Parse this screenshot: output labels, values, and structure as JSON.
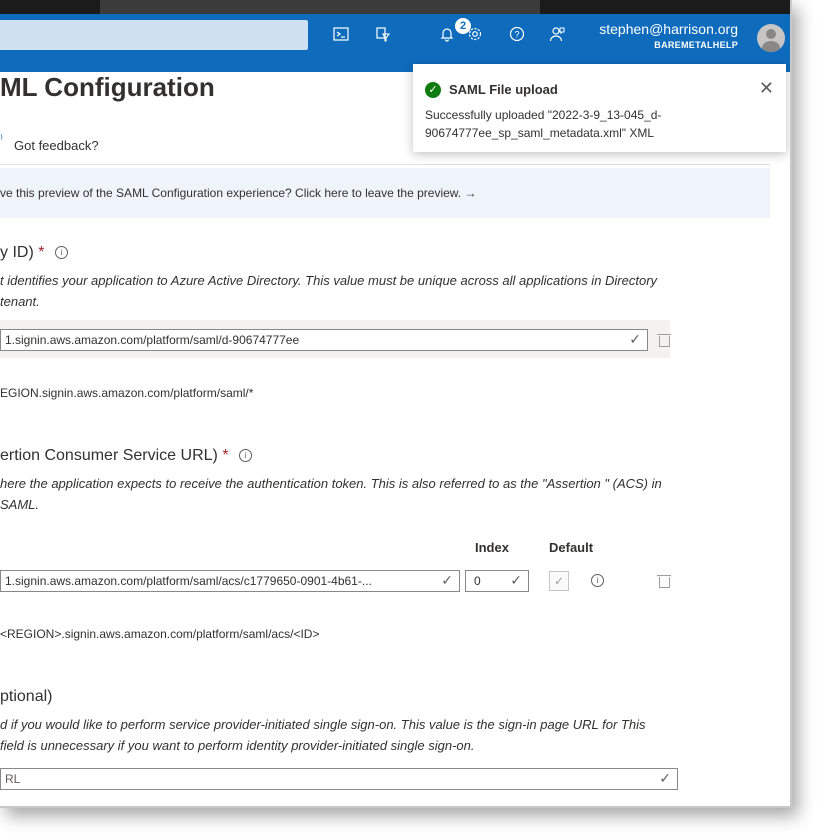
{
  "topbar": {
    "icons": [
      {
        "name": "cloud-shell-icon",
        "glyph": "⊡"
      },
      {
        "name": "directory-filter-icon",
        "glyph": "⛶"
      },
      {
        "name": "notifications-icon",
        "glyph": "🔔"
      },
      {
        "name": "settings-icon",
        "glyph": "⚙"
      },
      {
        "name": "help-icon",
        "glyph": "?"
      },
      {
        "name": "feedback-person-icon",
        "glyph": "☺"
      }
    ],
    "notification_count": "2",
    "user_email": "stephen@harrison.org",
    "tenant": "BAREMETALHELP"
  },
  "page": {
    "title": "ML Configuration",
    "feedback_label": "Got feedback?",
    "preview_banner": "ve this preview of the SAML Configuration experience? Click here to leave the preview.  →"
  },
  "identifier": {
    "title": "y ID)",
    "required_mark": "*",
    "description": "t identifies your application to Azure Active Directory. This value must be unique across all applications in Directory tenant.",
    "value": "1.signin.aws.amazon.com/platform/saml/d-90674777ee",
    "pattern": "EGION.signin.aws.amazon.com/platform/saml/*"
  },
  "reply_url": {
    "title": "ertion Consumer Service URL)",
    "required_mark": "*",
    "description": "here the application expects to receive the authentication token. This is also referred to as the \"Assertion \" (ACS) in SAML.",
    "index_header": "Index",
    "default_header": "Default",
    "value": "1.signin.aws.amazon.com/platform/saml/acs/c1779650-0901-4b61-...",
    "index_value": "0",
    "pattern": "<REGION>.signin.aws.amazon.com/platform/saml/acs/<ID>"
  },
  "signon_url": {
    "title": "ptional)",
    "description": "d if you would like to perform service provider-initiated single sign-on. This value is the sign-in page URL for This field is unnecessary if you want to perform identity provider-initiated single sign-on.",
    "placeholder": "RL"
  },
  "toast": {
    "title": "SAML File upload",
    "message": "Successfully uploaded \"2022-3-9_13-045_d-90674777ee_sp_saml_metadata.xml\" XML"
  },
  "colors": {
    "topbar": "#0f6cbd",
    "success": "#107c10",
    "required": "#a4262c"
  }
}
